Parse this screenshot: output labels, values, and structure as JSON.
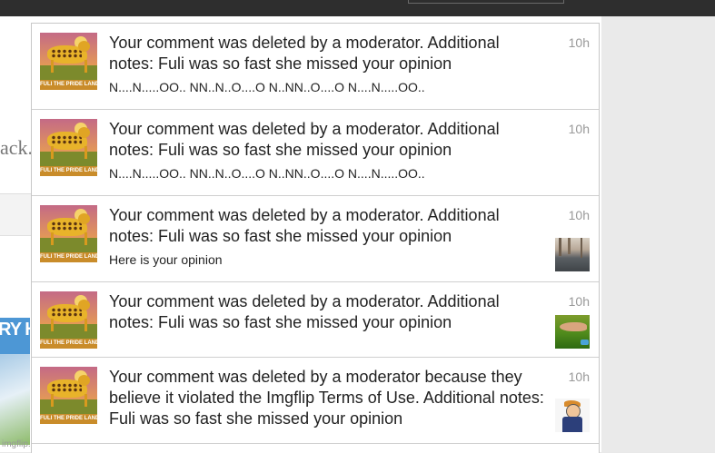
{
  "page": {
    "fragment_text": "ack.",
    "meme_text": "RY HA",
    "footer": "imgflip.com"
  },
  "notifications": [
    {
      "message": "Your comment was deleted by a moderator. Additional notes: Fuli was so fast she missed your opinion",
      "subtext": "N....N.....OO.. NN..N..O....O N..NN..O....O N....N.....OO..",
      "time": "10h",
      "thumbnail": null,
      "avatar_caption": "FULI THE PRIDE LAND'S FASTEST"
    },
    {
      "message": "Your comment was deleted by a moderator. Additional notes: Fuli was so fast she missed your opinion",
      "subtext": "N....N.....OO.. NN..N..O....O N..NN..O....O N....N.....OO..",
      "time": "10h",
      "thumbnail": null,
      "avatar_caption": "FULI THE PRIDE LAND'S FASTEST"
    },
    {
      "message": "Your comment was deleted by a moderator. Additional notes: Fuli was so fast she missed your opinion",
      "subtext": "Here is your opinion",
      "time": "10h",
      "thumbnail": "rocks-photo",
      "avatar_caption": "FULI THE PRIDE LAND'S FASTEST"
    },
    {
      "message": "Your comment was deleted by a moderator. Additional notes: Fuli was so fast she missed your opinion",
      "subtext": "",
      "time": "10h",
      "thumbnail": "grass-photo",
      "avatar_caption": "FULI THE PRIDE LAND'S FASTEST"
    },
    {
      "message": "Your comment was deleted by a moderator because they believe it violated the Imgflip Terms of Use. Additional notes: Fuli was so fast she missed your opinion",
      "subtext": "",
      "time": "10h",
      "thumbnail": "cartoon-meme",
      "avatar_caption": "FULI THE PRIDE LAND'S FASTEST"
    }
  ],
  "colors": {
    "topbar": "#2e2e2e",
    "panel_border": "#c8c8c8",
    "text": "#222222",
    "time": "#999999"
  }
}
